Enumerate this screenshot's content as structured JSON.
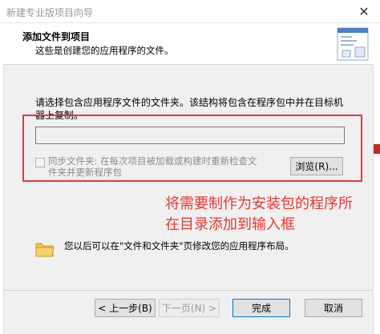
{
  "window": {
    "title": "新建专业版项目向导",
    "close_glyph": "✕"
  },
  "header": {
    "title": "添加文件到项目",
    "subtitle": "这些是创建您的应用程序的文件。"
  },
  "instruction": "请选择包含应用程序文件的文件夹。该结构将包含在程序包中并在目标机器上复制。",
  "path_field": {
    "value": "",
    "placeholder": ""
  },
  "sync_option": {
    "label": "同步文件夹: 在每次项目被加载或构建时重新检查文件夹并更新程序包",
    "checked": false,
    "enabled": false
  },
  "browse_button": "浏览(R)...",
  "annotation": "将需要制作为安装包的程序所在目录添加到输入框",
  "hint": "您以后可以在\"文件和文件夹\"页修改您的应用程序布局。",
  "buttons": {
    "back": "< 上一步(B)",
    "next": "下一页(N) >",
    "finish": "完成",
    "cancel": "取消"
  },
  "colors": {
    "annotation": "#e53935",
    "disabled_text": "#9a9a9a"
  }
}
